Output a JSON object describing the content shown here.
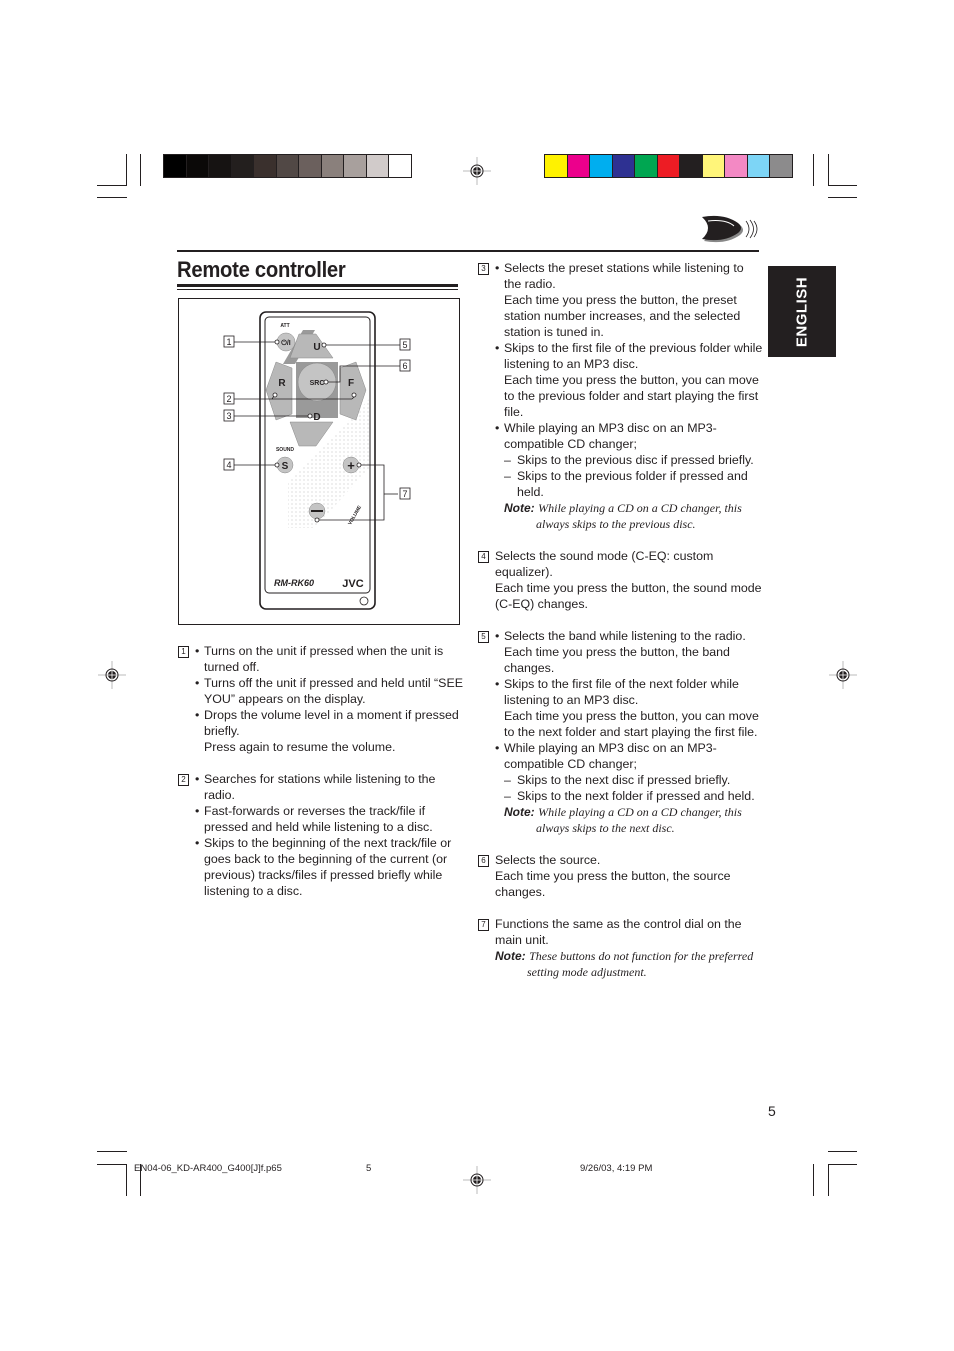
{
  "print_marks": {
    "gray_bar_colors": [
      "#000000",
      "#0b0908",
      "#161312",
      "#231f1e",
      "#3a302d",
      "#514845",
      "#6b605d",
      "#8a807c",
      "#a8a09d",
      "#d1cbca",
      "#ffffff"
    ],
    "color_bar_colors": [
      "#fff200",
      "#ec008c",
      "#00aeef",
      "#2e3192",
      "#00a651",
      "#ed1c24",
      "#231f20",
      "#fff57a",
      "#f389c4",
      "#7dd5f6",
      "#8c8b8c"
    ]
  },
  "header": {
    "title": "Remote controller",
    "language_tab": "ENGLISH",
    "nav_icon": "chapter-arrow-icon"
  },
  "remote": {
    "model": "RM-RK60",
    "brand": "JVC",
    "labels": {
      "att": "ATT",
      "power": "⏻/I",
      "up": "U",
      "down": "D",
      "left": "R",
      "right": "F",
      "source": "SRC",
      "sound_label": "SOUND",
      "sound": "S",
      "volume": "VOLUME",
      "vol_plus": "+",
      "vol_minus": "–"
    },
    "callouts": [
      "1",
      "2",
      "3",
      "4",
      "5",
      "6",
      "7"
    ]
  },
  "left_column": [
    {
      "num": "1",
      "items": [
        {
          "type": "bullet",
          "text": "Turns on the unit if pressed when the unit is turned off."
        },
        {
          "type": "bullet",
          "text": "Turns off the unit if pressed and held until “SEE YOU” appears on the display."
        },
        {
          "type": "bullet",
          "text": "Drops the volume level in a moment if pressed briefly."
        },
        {
          "type": "para",
          "text": "Press again to resume the volume."
        }
      ]
    },
    {
      "num": "2",
      "items": [
        {
          "type": "bullet",
          "text": "Searches for stations while listening to the radio."
        },
        {
          "type": "bullet",
          "text": "Fast-forwards or reverses the track/file if pressed and held while listening to a disc."
        },
        {
          "type": "bullet",
          "text": "Skips to the beginning of the next track/file or goes back to the beginning of the current (or previous) tracks/files if pressed briefly while listening to a disc."
        }
      ]
    }
  ],
  "right_column": [
    {
      "num": "3",
      "items": [
        {
          "type": "bullet",
          "text": "Selects the preset stations while listening to the radio."
        },
        {
          "type": "para",
          "text": "Each time you press the button, the preset station number increases, and the selected station is tuned in."
        },
        {
          "type": "bullet",
          "text": "Skips to the first file of the previous folder while listening to an MP3 disc."
        },
        {
          "type": "para",
          "text": "Each time you press the button, you can move to the previous folder and start playing the first file."
        },
        {
          "type": "bullet",
          "text": "While playing an MP3 disc on an MP3-compatible CD changer;"
        },
        {
          "type": "dash",
          "text": "Skips to the previous disc if pressed briefly."
        },
        {
          "type": "dash",
          "text": "Skips to the previous folder if pressed and held."
        },
        {
          "type": "note",
          "label": "Note:",
          "text": "While playing a CD on a CD changer, this always skips to the previous disc."
        }
      ]
    },
    {
      "num": "4",
      "items": [
        {
          "type": "plain",
          "text": "Selects the sound mode (C-EQ: custom equalizer)."
        },
        {
          "type": "plain",
          "text": "Each time you press the button, the sound mode (C-EQ) changes."
        }
      ]
    },
    {
      "num": "5",
      "items": [
        {
          "type": "bullet",
          "text": "Selects the band while listening to the radio."
        },
        {
          "type": "para",
          "text": "Each time you press the button, the band changes."
        },
        {
          "type": "bullet",
          "text": "Skips to the first file of the next folder while listening to an MP3 disc."
        },
        {
          "type": "para",
          "text": "Each time you press the button, you can move to the next folder and start playing the first file."
        },
        {
          "type": "bullet",
          "text": "While playing an MP3 disc on an MP3-compatible CD changer;"
        },
        {
          "type": "dash",
          "text": "Skips to the next disc if pressed briefly."
        },
        {
          "type": "dash",
          "text": "Skips to the next folder if pressed and held."
        },
        {
          "type": "note",
          "label": "Note:",
          "text": "While playing a CD on a CD changer, this always skips to the next disc."
        }
      ]
    },
    {
      "num": "6",
      "items": [
        {
          "type": "plain",
          "text": "Selects the source."
        },
        {
          "type": "plain",
          "text": "Each time you press the button, the source changes."
        }
      ]
    },
    {
      "num": "7",
      "items": [
        {
          "type": "plain",
          "text": "Functions the same as the control dial on the main unit."
        },
        {
          "type": "note",
          "label": "Note:",
          "text": "These buttons do not function for the preferred setting mode adjustment.",
          "plain": true
        }
      ]
    }
  ],
  "page_number": "5",
  "footer": {
    "file": "EN04-06_KD-AR400_G400[J]f.p65",
    "page": "5",
    "timestamp": "9/26/03, 4:19 PM"
  }
}
